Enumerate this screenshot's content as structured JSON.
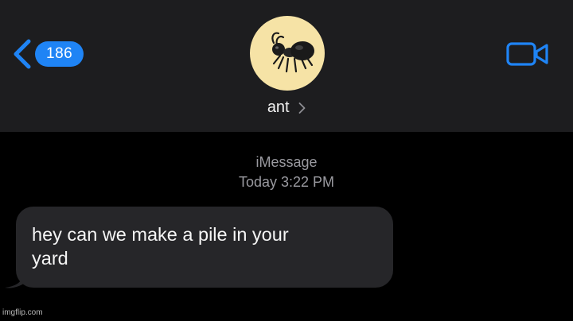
{
  "header": {
    "back_badge_count": "186",
    "contact_name": "ant",
    "avatar_icon": "ant-emoji-icon",
    "video_icon": "video-camera-icon",
    "accent_color": "#1f84f5"
  },
  "conversation": {
    "service_label": "iMessage",
    "timestamp": "Today 3:22 PM",
    "messages": [
      {
        "direction": "incoming",
        "text_line_1": "hey can we make a pile in your",
        "text_line_2": "yard"
      }
    ]
  },
  "watermark": "imgflip.com"
}
